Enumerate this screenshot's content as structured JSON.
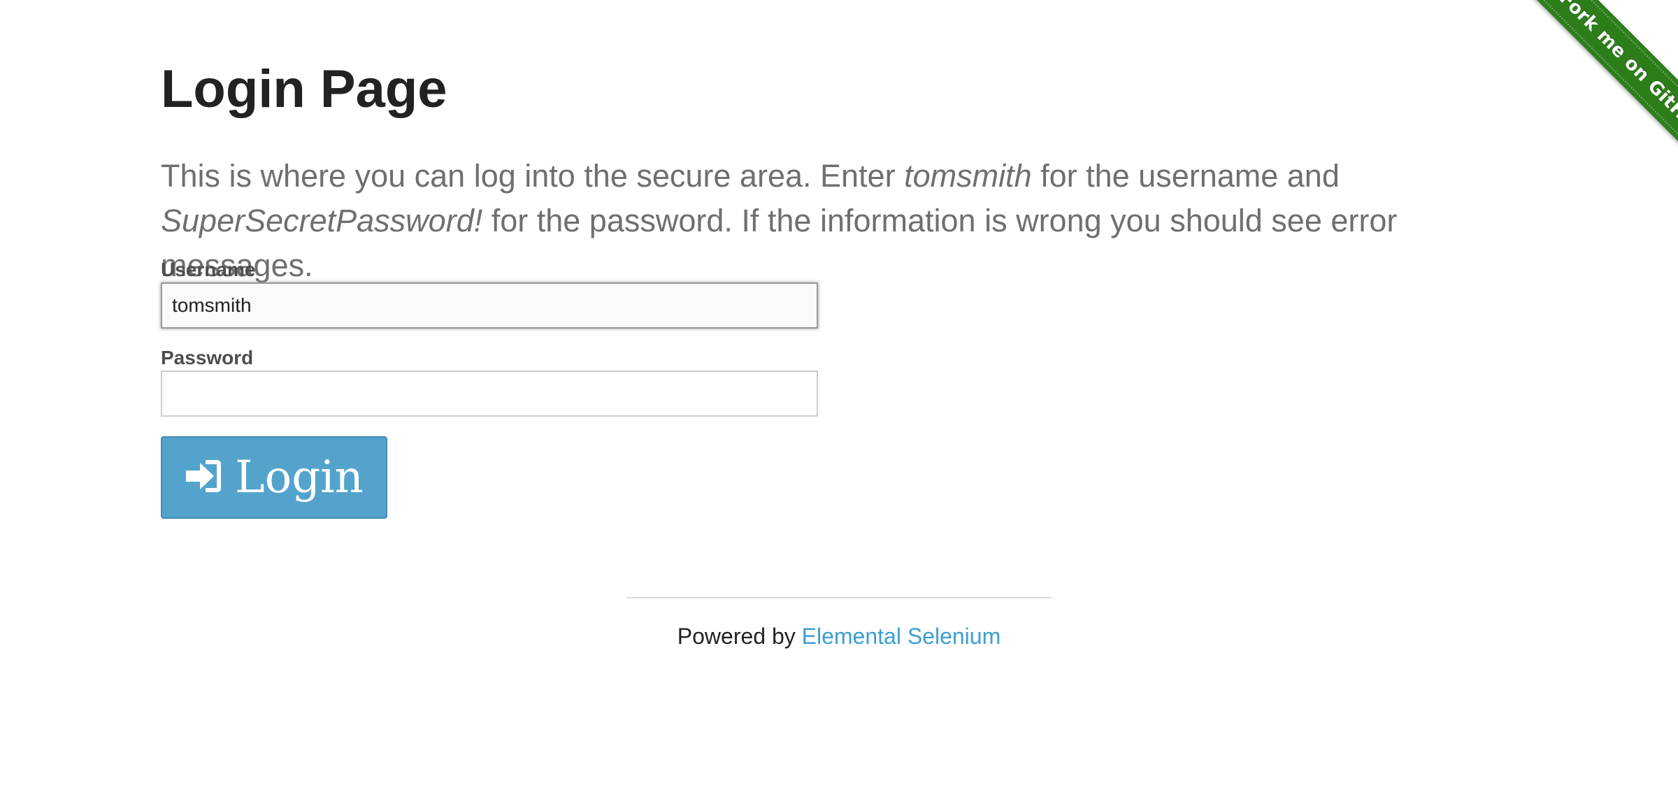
{
  "ribbon": {
    "label": "Fork me on GitHub",
    "color": "#2e7d1b"
  },
  "page": {
    "title": "Login Page",
    "subheader": {
      "part1": "This is where you can log into the secure area. Enter ",
      "username_hint": "tomsmith",
      "part2": " for the username and ",
      "password_hint": "SuperSecretPassword!",
      "part3": " for the password. If the information is wrong you should see error messages."
    }
  },
  "form": {
    "username": {
      "label": "Username",
      "value": "tomsmith"
    },
    "password": {
      "label": "Password",
      "value": ""
    },
    "login_button": {
      "label": "Login",
      "icon": "sign-in-icon",
      "color": "#53a3cd"
    }
  },
  "footer": {
    "prefix": "Powered by ",
    "link_text": "Elemental Selenium",
    "link_color": "#3b9fd0"
  }
}
